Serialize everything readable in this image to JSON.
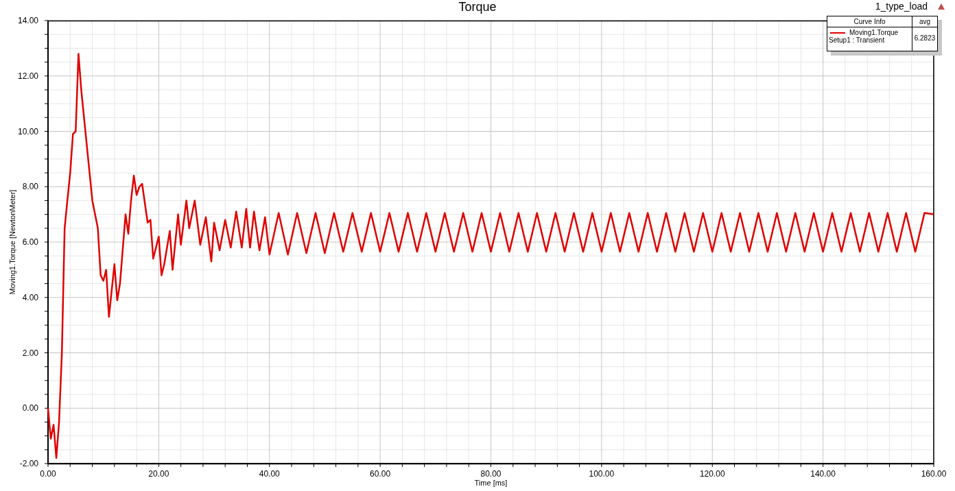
{
  "plot": {
    "design": "1_type_load",
    "legend": {
      "columns": [
        "Curve Info",
        "avg"
      ],
      "rows": [
        {
          "setup": "Setup1 : Transient",
          "avg": "6.2823"
        }
      ]
    },
    "chart_data": {
      "type": "line",
      "grid": true,
      "title": "Torque",
      "xlabel": "Time [ms]",
      "ylabel": "Moving1.Torque [NewtonMeter]",
      "xlim": [
        0,
        160
      ],
      "ylim": [
        -2,
        14
      ],
      "xticks": [
        {
          "value": 0,
          "label": "0.00"
        },
        {
          "value": 20,
          "label": "20.00"
        },
        {
          "value": 40,
          "label": "40.00"
        },
        {
          "value": 60,
          "label": "60.00"
        },
        {
          "value": 80,
          "label": "80.00"
        },
        {
          "value": 100,
          "label": "100.00"
        },
        {
          "value": 120,
          "label": "120.00"
        },
        {
          "value": 140,
          "label": "140.00"
        },
        {
          "value": 160,
          "label": "160.00"
        }
      ],
      "yticks": [
        {
          "value": -2,
          "label": "-2.00"
        },
        {
          "value": 0,
          "label": "0.00"
        },
        {
          "value": 2,
          "label": "2.00"
        },
        {
          "value": 4,
          "label": "4.00"
        },
        {
          "value": 6,
          "label": "6.00"
        },
        {
          "value": 8,
          "label": "8.00"
        },
        {
          "value": 10,
          "label": "10.00"
        },
        {
          "value": 12,
          "label": "12.00"
        },
        {
          "value": 14,
          "label": "14.00"
        }
      ],
      "x": [
        0,
        0.5,
        1,
        1.5,
        2,
        2.5,
        3,
        3.5,
        4,
        4.5,
        5,
        5.5,
        6,
        7,
        8,
        9,
        9.5,
        10,
        10.5,
        11,
        12,
        12.5,
        13,
        14,
        14.5,
        15,
        15.5,
        16,
        16.5,
        17,
        18,
        18.5,
        19,
        20,
        20.5,
        21,
        22,
        22.5,
        23.5,
        24,
        25,
        25.5,
        26.5,
        27.5,
        28.5,
        29.5,
        30,
        31,
        32,
        33,
        34,
        35,
        35.8,
        36.5,
        37.2,
        38.2,
        39.2,
        40,
        41.67,
        43.33,
        45,
        46.67,
        48.33,
        50,
        51.67,
        53.33,
        55,
        56.67,
        58.33,
        60,
        61.67,
        63.33,
        65,
        66.67,
        68.33,
        70,
        71.67,
        73.33,
        75,
        76.67,
        78.33,
        80,
        81.67,
        83.33,
        85,
        86.67,
        88.33,
        90,
        91.67,
        93.33,
        95,
        96.67,
        98.33,
        100,
        101.67,
        103.33,
        105,
        106.67,
        108.33,
        110,
        111.67,
        113.33,
        115,
        116.67,
        118.33,
        120,
        121.67,
        123.33,
        125,
        126.67,
        128.33,
        130,
        131.67,
        133.33,
        135,
        136.67,
        138.33,
        140,
        141.67,
        143.33,
        145,
        146.67,
        148.33,
        150,
        151.67,
        153.33,
        155,
        156.67,
        158.33,
        160
      ],
      "series": [
        {
          "name": "Moving1.Torque",
          "color": "#e00000",
          "values": [
            0,
            -1.1,
            -0.6,
            -1.8,
            -0.5,
            2,
            6.5,
            7.5,
            8.5,
            9.9,
            10,
            12.8,
            11.5,
            9.5,
            7.5,
            6.5,
            4.8,
            4.6,
            5,
            3.3,
            5.2,
            3.9,
            4.5,
            7,
            6.3,
            7.5,
            8.4,
            7.7,
            8,
            8.1,
            6.7,
            6.8,
            5.4,
            6.2,
            4.8,
            5.2,
            6.4,
            5,
            7,
            5.9,
            7.5,
            6.5,
            7.5,
            5.9,
            6.9,
            5.3,
            6.7,
            5.7,
            6.8,
            5.8,
            7.1,
            5.8,
            7.2,
            5.8,
            7.1,
            5.7,
            6.9,
            5.55,
            7.05,
            5.55,
            7.05,
            5.6,
            7.05,
            5.6,
            7.05,
            5.65,
            7.05,
            5.65,
            7.05,
            5.65,
            7.05,
            5.65,
            7.05,
            5.65,
            7.05,
            5.65,
            7.05,
            5.65,
            7.05,
            5.65,
            7.05,
            5.65,
            7.05,
            5.65,
            7.05,
            5.65,
            7.05,
            5.65,
            7.05,
            5.65,
            7.05,
            5.65,
            7.05,
            5.65,
            7.05,
            5.65,
            7.05,
            5.65,
            7.05,
            5.65,
            7.05,
            5.65,
            7.05,
            5.65,
            7.05,
            5.65,
            7.05,
            5.65,
            7.05,
            5.65,
            7.05,
            5.65,
            7.05,
            5.65,
            7.05,
            5.65,
            7.05,
            5.65,
            7.05,
            5.65,
            7.05,
            5.65,
            7.05,
            5.65,
            7.05,
            5.65,
            7.05,
            5.65,
            7.05,
            7.0
          ]
        }
      ]
    }
  }
}
